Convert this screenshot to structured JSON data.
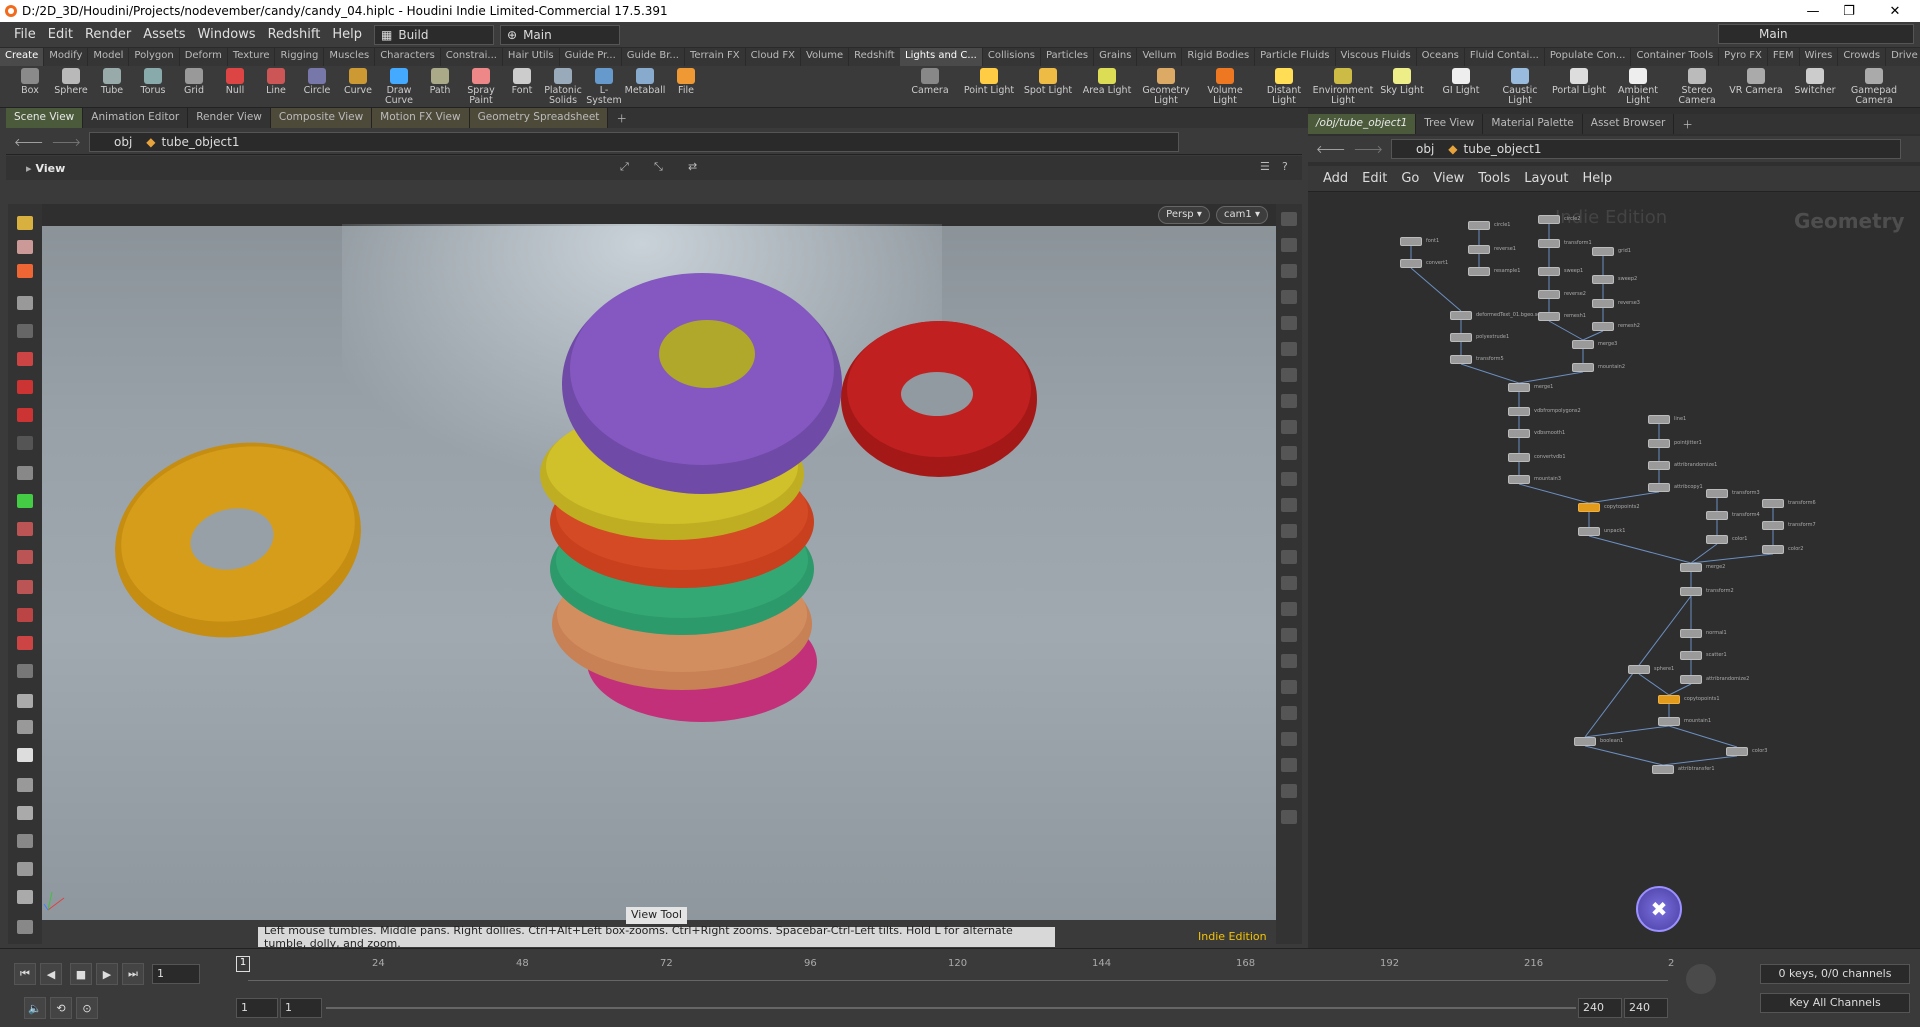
{
  "window": {
    "title": "D:/2D_3D/Houdini/Projects/nodevember/candy/candy_04.hiplc - Houdini Indie Limited-Commercial 17.5.391",
    "minimize": "—",
    "maximize": "❐",
    "close": "✕"
  },
  "menubar": {
    "items": [
      "File",
      "Edit",
      "Render",
      "Assets",
      "Windows",
      "Redshift",
      "Help"
    ],
    "desktop": "Build",
    "context": "Main",
    "right_context": "Main"
  },
  "shelf_left": {
    "tabs": [
      "Create",
      "Modify",
      "Model",
      "Polygon",
      "Deform",
      "Texture",
      "Rigging",
      "Muscles",
      "Characters",
      "Constrai...",
      "Hair Utils",
      "Guide Pr...",
      "Guide Br...",
      "Terrain FX",
      "Cloud FX",
      "Volume",
      "Redshift"
    ],
    "tools": [
      "Box",
      "Sphere",
      "Tube",
      "Torus",
      "Grid",
      "Null",
      "Line",
      "Circle",
      "Curve",
      "Draw Curve",
      "Path",
      "Spray Paint",
      "Font",
      "Platonic Solids",
      "L-System",
      "Metaball",
      "File"
    ]
  },
  "shelf_right": {
    "tabs": [
      "Lights and C...",
      "Collisions",
      "Particles",
      "Grains",
      "Vellum",
      "Rigid Bodies",
      "Particle Fluids",
      "Viscous Fluids",
      "Oceans",
      "Fluid Contai...",
      "Populate Con...",
      "Container Tools",
      "Pyro FX",
      "FEM",
      "Wires",
      "Crowds",
      "Drive Simula..."
    ],
    "tools": [
      "Camera",
      "Point Light",
      "Spot Light",
      "Area Light",
      "Geometry Light",
      "Volume Light",
      "Distant Light",
      "Environment Light",
      "Sky Light",
      "GI Light",
      "Caustic Light",
      "Portal Light",
      "Ambient Light",
      "Stereo Camera",
      "VR Camera",
      "Switcher",
      "Gamepad Camera"
    ]
  },
  "left_pane": {
    "tabs": [
      "Scene View",
      "Animation Editor",
      "Render View",
      "Composite View",
      "Motion FX View",
      "Geometry Spreadsheet"
    ],
    "path_root": "obj",
    "path_node": "tube_object1",
    "view_label": "View",
    "persp": "Persp ▾",
    "cam": "cam1 ▾",
    "tooltip": "View Tool",
    "hint": "Left mouse tumbles. Middle pans. Right dollies. Ctrl+Alt+Left box-zooms. Ctrl+Right zooms. Spacebar-Ctrl-Left tilts. Hold L for alternate tumble, dolly, and zoom.",
    "edition": "Indie Edition"
  },
  "right_pane": {
    "tabs": [
      "/obj/tube_object1",
      "Tree View",
      "Material Palette",
      "Asset Browser"
    ],
    "path_root": "obj",
    "path_node": "tube_object1",
    "menu": [
      "Add",
      "Edit",
      "Go",
      "View",
      "Tools",
      "Layout",
      "Help"
    ],
    "watermark": "Indie Edition",
    "context_label": "Geometry"
  },
  "nodes": [
    {
      "label": "font1"
    },
    {
      "label": "circle1"
    },
    {
      "label": "circle2"
    },
    {
      "label": "convert1"
    },
    {
      "label": "reverse1"
    },
    {
      "label": "transform1"
    },
    {
      "label": "grid1"
    },
    {
      "label": "resample1"
    },
    {
      "label": "sweep1"
    },
    {
      "label": "sweep2"
    },
    {
      "label": "deformedText_01.bgeo.sc"
    },
    {
      "label": "reverse2"
    },
    {
      "label": "reverse3"
    },
    {
      "label": "polyextrude1"
    },
    {
      "label": "remesh1"
    },
    {
      "label": "remesh2"
    },
    {
      "label": "transform5"
    },
    {
      "label": "merge3"
    },
    {
      "label": "mountain2"
    },
    {
      "label": "merge1"
    },
    {
      "label": "vdbfrompolygons2"
    },
    {
      "label": "vdbsmooth1"
    },
    {
      "label": "convertvdb1"
    },
    {
      "label": "mountain3"
    },
    {
      "label": "line1"
    },
    {
      "label": "pointjitter1"
    },
    {
      "label": "attribrandomize1"
    },
    {
      "label": "attribcopy1"
    },
    {
      "label": "transform3"
    },
    {
      "label": "transform4"
    },
    {
      "label": "transform6"
    },
    {
      "label": "transform7"
    },
    {
      "label": "copytopoints2"
    },
    {
      "label": "unpack1"
    },
    {
      "label": "color1"
    },
    {
      "label": "color2"
    },
    {
      "label": "merge2"
    },
    {
      "label": "transform2"
    },
    {
      "label": "normal1"
    },
    {
      "label": "scatter1"
    },
    {
      "label": "sphere1"
    },
    {
      "label": "attribrandomize2"
    },
    {
      "label": "copytopoints1"
    },
    {
      "label": "mountain1"
    },
    {
      "label": "boolean1"
    },
    {
      "label": "color3"
    },
    {
      "label": "attribtransfer1"
    }
  ],
  "timeline": {
    "frame": "1",
    "ticks": [
      "24",
      "48",
      "72",
      "96",
      "120",
      "144",
      "168",
      "192",
      "216",
      "2"
    ],
    "start": "1",
    "start2": "1",
    "end": "240",
    "end2": "240",
    "keys": "0 keys, 0/0 channels",
    "channels": "Key All Channels"
  },
  "colors": {
    "accent_orange": "#e29b1a",
    "edition_yellow": "#f5c400",
    "wire": "#6b8fc2"
  }
}
